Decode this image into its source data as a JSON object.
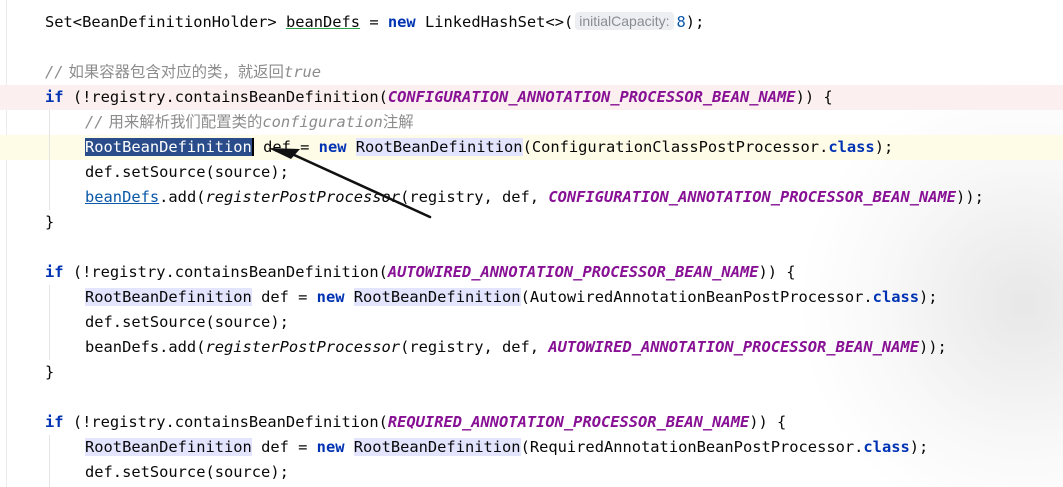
{
  "code": {
    "line1": {
      "type": "Set<BeanDefinitionHolder>",
      "var": "beanDefs",
      "eq": " = ",
      "new_kw": "new",
      "ctor": "LinkedHashSet<>(",
      "hint": "initialCapacity:",
      "arg": "8",
      "end": ");"
    },
    "comment1": {
      "slashes": "//",
      "text": " 如果容器包含对应的类，就返回",
      "tail": "true"
    },
    "block1": {
      "if_kw": "if",
      "cond_open": " (!registry.containsBeanDefinition(",
      "const": "CONFIGURATION_ANNOTATION_PROCESSOR_BEAN_NAME",
      "cond_close": ")) {",
      "comment_slashes": "//",
      "comment_a": " 用来解析我们配置类的",
      "comment_b": "configuration",
      "comment_c": "注解",
      "decl_type": "RootBeanDefinition",
      "decl_var": " def = ",
      "new_kw": "new",
      "ctor": "RootBeanDefinition",
      "arg_open": "(ConfigurationClassPostProcessor.",
      "class_kw": "class",
      "arg_close": ");",
      "set_source": "def.setSource(source);",
      "add_field": "beanDefs",
      "add_open": ".add(",
      "register_call": "registerPostProcessor",
      "add_args": "(registry, def, ",
      "add_const": "CONFIGURATION_ANNOTATION_PROCESSOR_BEAN_NAME",
      "add_close": "));",
      "close_brace": "}"
    },
    "block2": {
      "if_kw": "if",
      "cond_open": " (!registry.containsBeanDefinition(",
      "const": "AUTOWIRED_ANNOTATION_PROCESSOR_BEAN_NAME",
      "cond_close": ")) {",
      "decl_type": "RootBeanDefinition",
      "decl_var": " def = ",
      "new_kw": "new",
      "ctor": "RootBeanDefinition",
      "arg_open": "(AutowiredAnnotationBeanPostProcessor.",
      "class_kw": "class",
      "arg_close": ");",
      "set_source": "def.setSource(source);",
      "add_field": "beanDefs.add(",
      "register_call": "registerPostProcessor",
      "add_args": "(registry, def, ",
      "add_const": "AUTOWIRED_ANNOTATION_PROCESSOR_BEAN_NAME",
      "add_close": "));",
      "close_brace": "}"
    },
    "block3": {
      "if_kw": "if",
      "cond_open": " (!registry.containsBeanDefinition(",
      "const": "REQUIRED_ANNOTATION_PROCESSOR_BEAN_NAME",
      "cond_close": ")) {",
      "decl_type": "RootBeanDefinition",
      "decl_var": " def = ",
      "new_kw": "new",
      "ctor": "RootBeanDefinition",
      "arg_open": "(RequiredAnnotationBeanPostProcessor.",
      "class_kw": "class",
      "arg_close": ");",
      "set_source": "def.setSource(source);"
    }
  },
  "colors": {
    "keyword": "#0033b3",
    "constant": "#871094",
    "comment": "#8c8c8c",
    "selection": "#2a4c8a",
    "identifier_highlight": "#e3e5ff",
    "error_row": "#fcefef",
    "caret_row": "#fefbe6",
    "arrow": "#111111"
  },
  "annotation": {
    "type": "arrow",
    "points_to": "selected RootBeanDefinition"
  }
}
